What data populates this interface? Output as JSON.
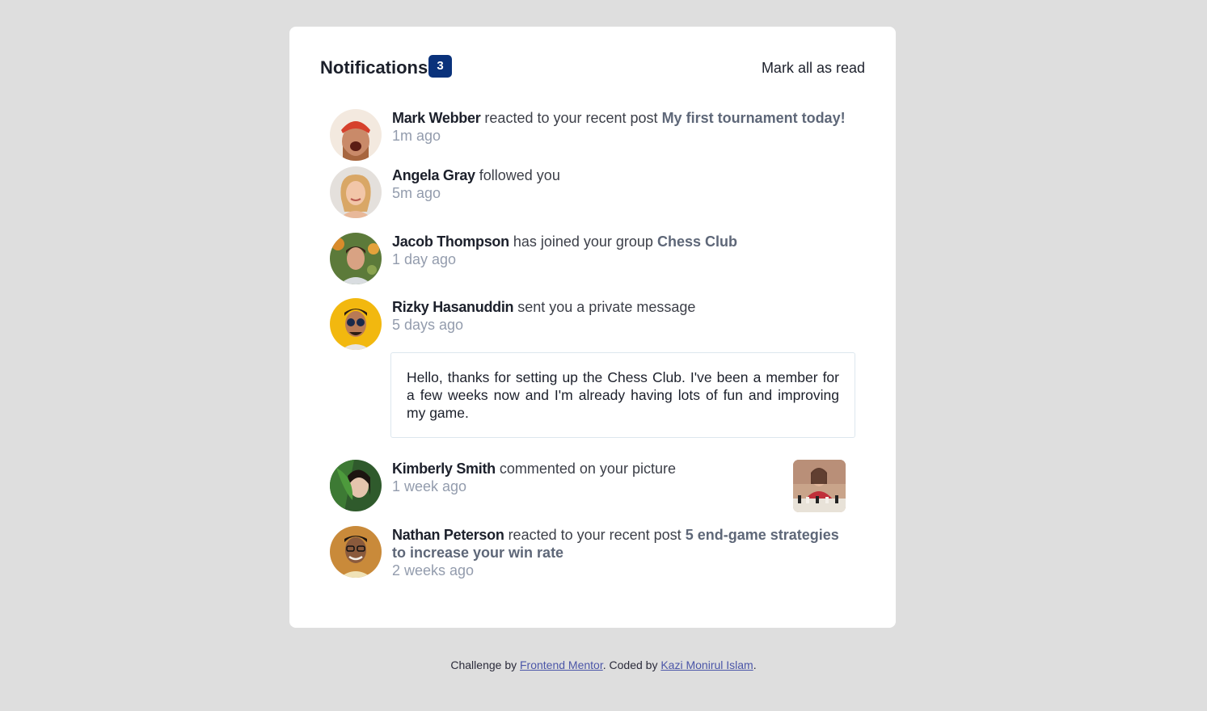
{
  "header": {
    "title": "Notifications",
    "unread_count": "3",
    "mark_all_label": "Mark all as read"
  },
  "notifications": [
    {
      "name": "Mark Webber",
      "action": "reacted to your recent post",
      "target": "My first tournament today!",
      "time": "1m ago"
    },
    {
      "name": "Angela Gray",
      "action": "followed you",
      "target": "",
      "time": "5m ago"
    },
    {
      "name": "Jacob Thompson",
      "action": "has joined your group",
      "target": "Chess Club",
      "time": "1 day ago"
    },
    {
      "name": "Rizky Hasanuddin",
      "action": "sent you a private message",
      "target": "",
      "time": "5 days ago",
      "message": "Hello, thanks for setting up the Chess Club. I've been a member for a few weeks now and I'm already having lots of fun and improving my game."
    },
    {
      "name": "Kimberly Smith",
      "action": "commented on your picture",
      "target": "",
      "time": "1 week ago"
    },
    {
      "name": "Nathan Peterson",
      "action": "reacted to your recent post",
      "target": "5 end-game strategies to increase your win rate",
      "time": "2 weeks ago"
    }
  ],
  "footer": {
    "prefix": "Challenge by",
    "link1": "Frontend Mentor",
    "middle": ". Coded by",
    "link2": "Kazi Monirul Islam",
    "suffix": "."
  },
  "colors": {
    "background": "#dedede",
    "badge": "#0a327b",
    "name": "#1c202b",
    "target": "#5e6778",
    "time": "#939cad"
  }
}
